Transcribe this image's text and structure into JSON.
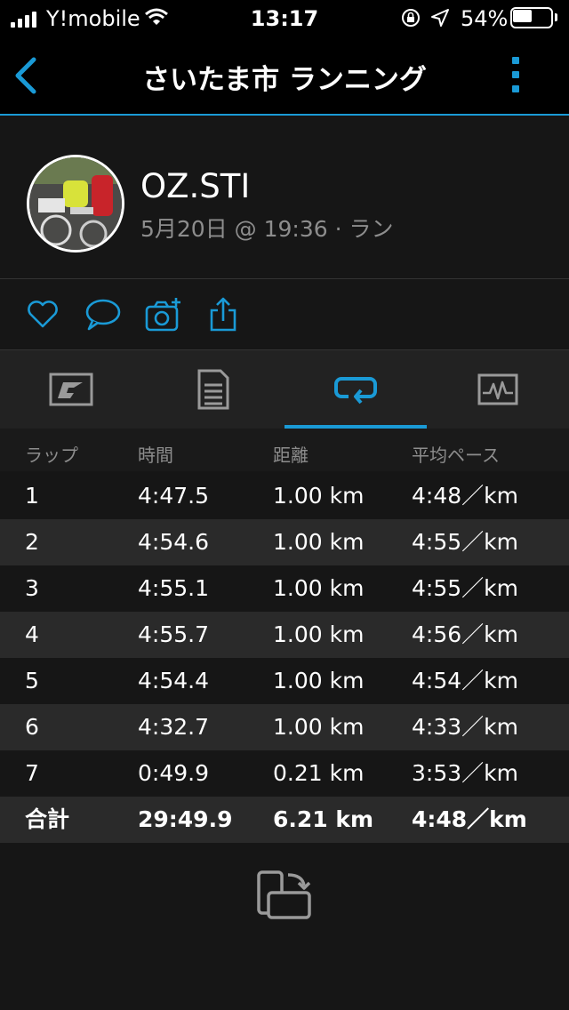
{
  "status_bar": {
    "carrier": "Y!mobile",
    "time": "13:17",
    "battery_percent": "54%",
    "battery_level": 0.54
  },
  "nav": {
    "title": "さいたま市 ランニング"
  },
  "activity": {
    "user_name": "OZ.STI",
    "meta": "5月20日 @ 19:36 · ラン"
  },
  "actions": {
    "icons": [
      "heart-icon",
      "comment-icon",
      "add-photo-icon",
      "share-icon"
    ]
  },
  "tabs": {
    "items": [
      "overview-tab",
      "stats-tab",
      "laps-tab",
      "charts-tab"
    ],
    "active": "laps-tab"
  },
  "laps_table": {
    "headers": [
      "ラップ",
      "時間",
      "距離",
      "平均ペース"
    ],
    "rows": [
      [
        "1",
        "4:47.5",
        "1.00 km",
        "4:48／km"
      ],
      [
        "2",
        "4:54.6",
        "1.00 km",
        "4:55／km"
      ],
      [
        "3",
        "4:55.1",
        "1.00 km",
        "4:55／km"
      ],
      [
        "4",
        "4:55.7",
        "1.00 km",
        "4:56／km"
      ],
      [
        "5",
        "4:54.4",
        "1.00 km",
        "4:54／km"
      ],
      [
        "6",
        "4:32.7",
        "1.00 km",
        "4:33／km"
      ],
      [
        "7",
        "0:49.9",
        "0.21 km",
        "3:53／km"
      ]
    ],
    "total": [
      "合計",
      "29:49.9",
      "6.21 km",
      "4:48／km"
    ]
  },
  "colors": {
    "accent": "#1a9ad6",
    "background": "#161616",
    "row_alt": "#2a2a2a",
    "muted_text": "#8d8d8d"
  }
}
